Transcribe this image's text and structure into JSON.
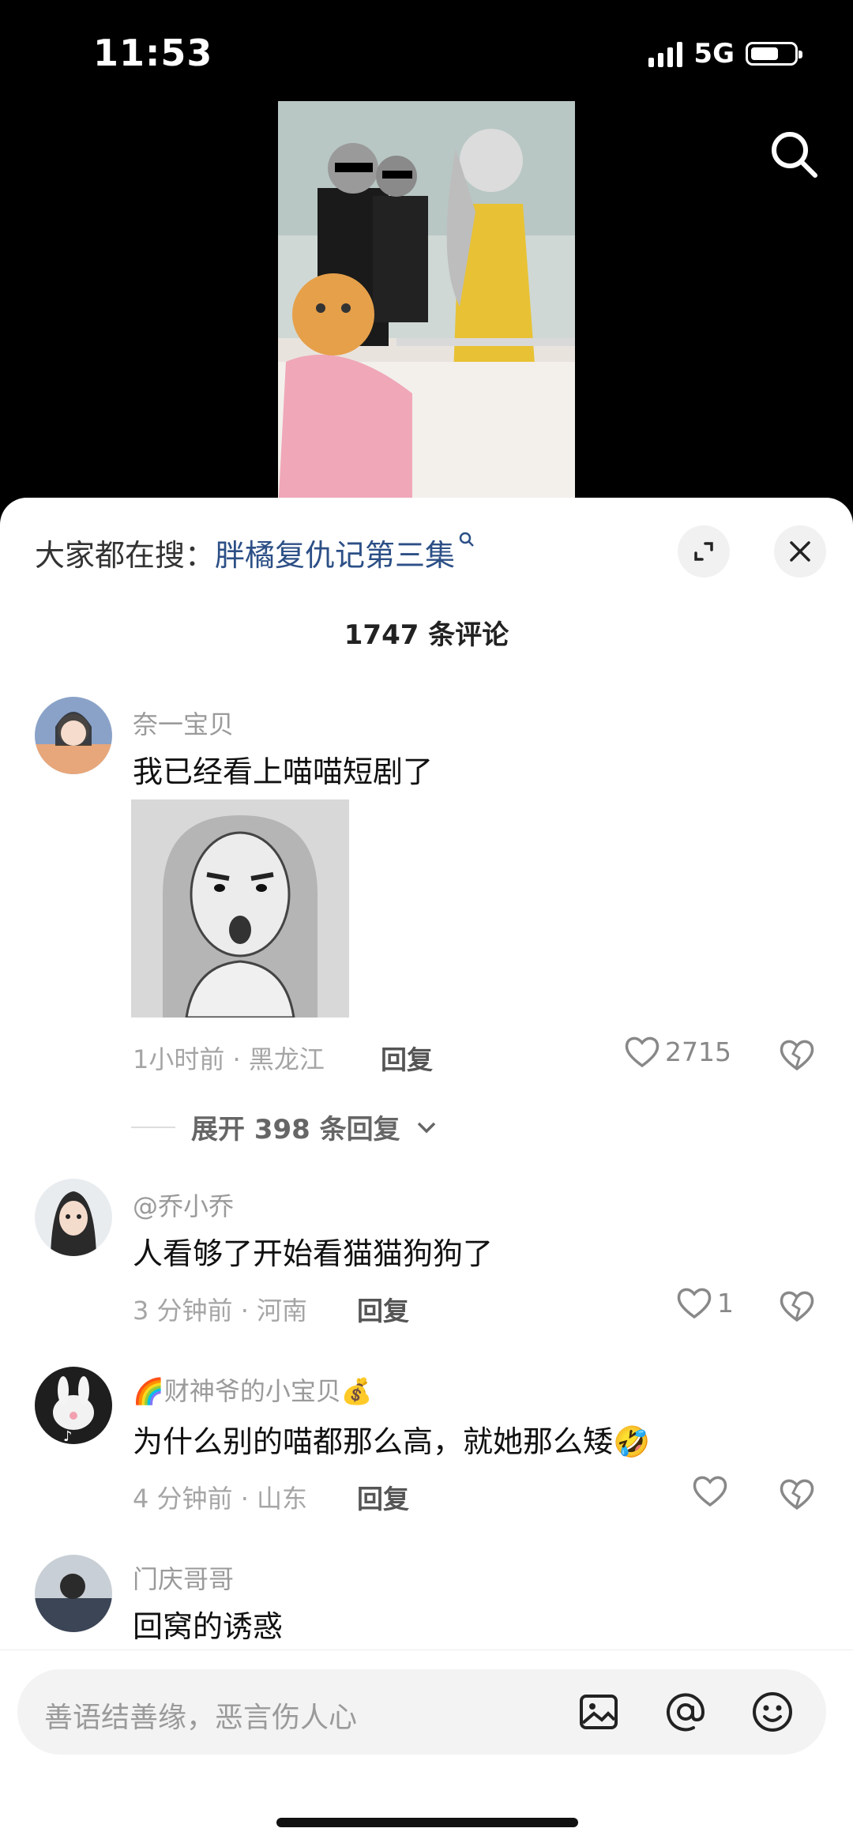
{
  "status": {
    "time": "11:53",
    "network": "5G",
    "battery_level": 0.65
  },
  "hot_search": {
    "prefix": "大家都在搜：",
    "keyword": "胖橘复仇记第三集"
  },
  "comment_count": "1747 条评论",
  "comments": [
    {
      "username": "奈一宝贝",
      "text": "我已经看上喵喵短剧了",
      "time_location": "1小时前 · 黑龙江",
      "reply_label": "回复",
      "likes": "2715",
      "expand_label": "展开 398 条回复"
    },
    {
      "username": "@乔小乔",
      "text": "人看够了开始看猫猫狗狗了",
      "time_location": "3 分钟前 · 河南",
      "reply_label": "回复",
      "likes": "1"
    },
    {
      "username": "财神爷的小宝贝",
      "text": "为什么别的喵都那么高，就她那么矮",
      "time_location": "4 分钟前 · 山东",
      "reply_label": "回复",
      "likes": ""
    },
    {
      "username": "门庆哥哥",
      "text": "回窝的诱惑"
    }
  ],
  "input": {
    "placeholder": "善语结善缘，恶言伤人心"
  },
  "icons": {
    "search": "search-icon",
    "expand": "expand-icon",
    "close": "close-icon",
    "like": "heart-icon",
    "dislike": "broken-heart-icon",
    "image": "image-icon",
    "mention": "at-icon",
    "emoji": "emoji-icon"
  }
}
